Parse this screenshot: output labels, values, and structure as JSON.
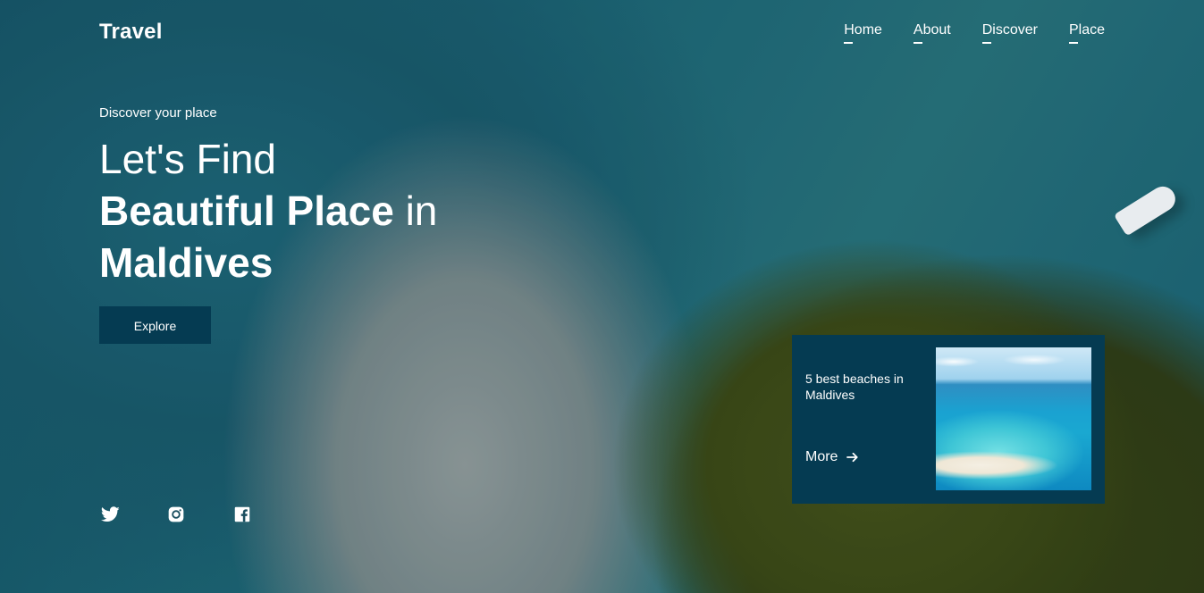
{
  "header": {
    "logo": "Travel",
    "nav": [
      {
        "label": "Home"
      },
      {
        "label": "About"
      },
      {
        "label": "Discover"
      },
      {
        "label": "Place"
      }
    ]
  },
  "hero": {
    "subtitle": "Discover your place",
    "line1": "Let's Find",
    "line2_bold": "Beautiful Place",
    "line2_light": "in",
    "line3_bold": "Maldives",
    "explore_label": "Explore"
  },
  "socials": [
    {
      "icon": "twitter-icon"
    },
    {
      "icon": "instagram-icon"
    },
    {
      "icon": "facebook-icon"
    }
  ],
  "card": {
    "title": "5 best beaches in Maldives",
    "more_label": "More"
  },
  "colors": {
    "accent": "#053b52",
    "text": "#ffffff"
  }
}
